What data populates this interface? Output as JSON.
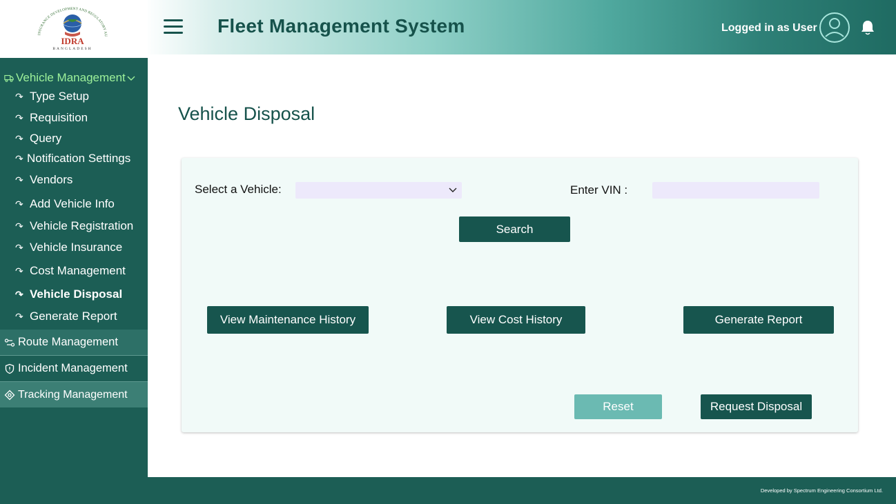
{
  "header": {
    "logo_text": "IDRA",
    "logo_subtext": "BANGLADESH",
    "logo_ring_text": "INSURANCE DEVELOPMENT AND REGULATORY AUTHORITY",
    "title": "Fleet Management System",
    "logged_in_text": "Logged in as User",
    "menu_icon": "hamburger-menu-icon",
    "avatar_icon": "user-avatar-icon",
    "notification_icon": "bell-icon"
  },
  "sidebar": {
    "vehicle_management": {
      "label": "Vehicle Management",
      "icon": "truck-icon",
      "items": [
        {
          "label": "Type Setup"
        },
        {
          "label": "Requisition"
        },
        {
          "label": "Query"
        },
        {
          "label": "Notification Settings"
        },
        {
          "label": "Vendors"
        },
        {
          "label": "Add Vehicle Info"
        },
        {
          "label": "Vehicle Registration"
        },
        {
          "label": "Vehicle Insurance"
        },
        {
          "label": "Cost Management"
        },
        {
          "label": "Vehicle Disposal",
          "active": true
        },
        {
          "label": "Generate Report"
        }
      ]
    },
    "route_management": "Route Management",
    "incident_management": "Incident Management",
    "tracking_management": "Tracking Management"
  },
  "main": {
    "page_title": "Vehicle Disposal",
    "form": {
      "select_vehicle_label": "Select a Vehicle:",
      "select_vehicle_value": "",
      "vin_label": "Enter VIN :",
      "vin_value": "",
      "vin_placeholder": "",
      "search_button": "Search",
      "view_maintenance_button": "View Maintenance History",
      "view_cost_button": "View Cost History",
      "generate_report_button": "Generate Report",
      "reset_button": "Reset",
      "request_disposal_button": "Request Disposal"
    }
  },
  "footer": {
    "credit": "Developed by Spectrum Engineering Consortium Ltd."
  },
  "colors": {
    "primary": "#17554e",
    "sidebar": "#1c5e55",
    "sidebar_highlight": "#9df19a",
    "reset": "#6bbab2",
    "input_bg": "#ede9fb",
    "card_bg": "#f1faf8"
  }
}
